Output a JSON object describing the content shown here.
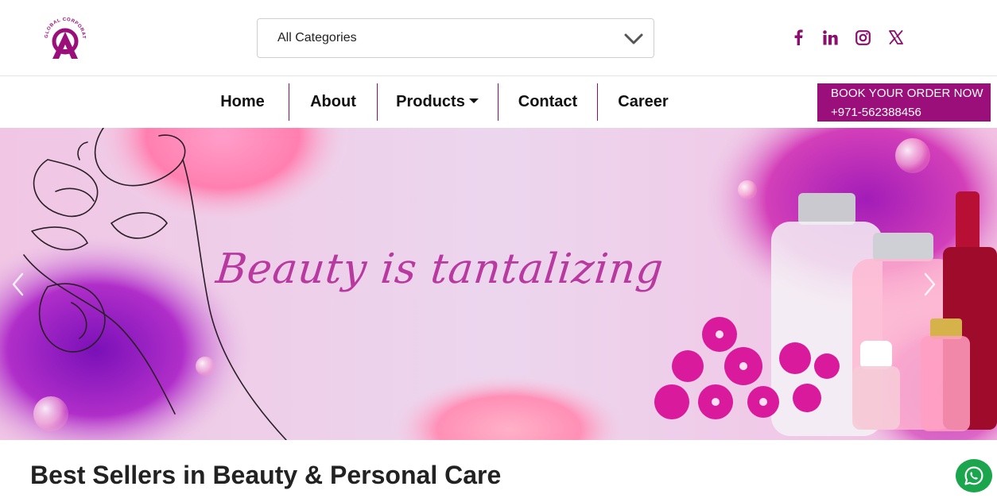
{
  "brand": {
    "logo_text": "GLOBAL CORPORATION",
    "logo_icon": "ac-monogram-logo",
    "accent_color": "#9b0f7b"
  },
  "header": {
    "category_select": {
      "selected": "All Categories",
      "icon": "chevron-down-icon"
    },
    "social_links": [
      {
        "name": "facebook",
        "icon": "facebook-icon"
      },
      {
        "name": "linkedin",
        "icon": "linkedin-icon"
      },
      {
        "name": "instagram",
        "icon": "instagram-icon"
      },
      {
        "name": "x",
        "icon": "x-icon"
      }
    ]
  },
  "nav": {
    "items": [
      {
        "label": "Home"
      },
      {
        "label": "About"
      },
      {
        "label": "Products",
        "has_dropdown": true
      },
      {
        "label": "Contact"
      },
      {
        "label": "Career"
      }
    ],
    "cta": {
      "line1": "BOOK YOUR ORDER NOW",
      "line2": "+971-562388456"
    }
  },
  "hero": {
    "tagline": "Beauty is tantalizing",
    "prev_icon": "chevron-left-icon",
    "next_icon": "chevron-right-icon"
  },
  "section": {
    "title": "Best Sellers in Beauty & Personal Care"
  },
  "floating": {
    "whatsapp_icon": "whatsapp-icon",
    "whatsapp_color": "#1ba54c"
  }
}
